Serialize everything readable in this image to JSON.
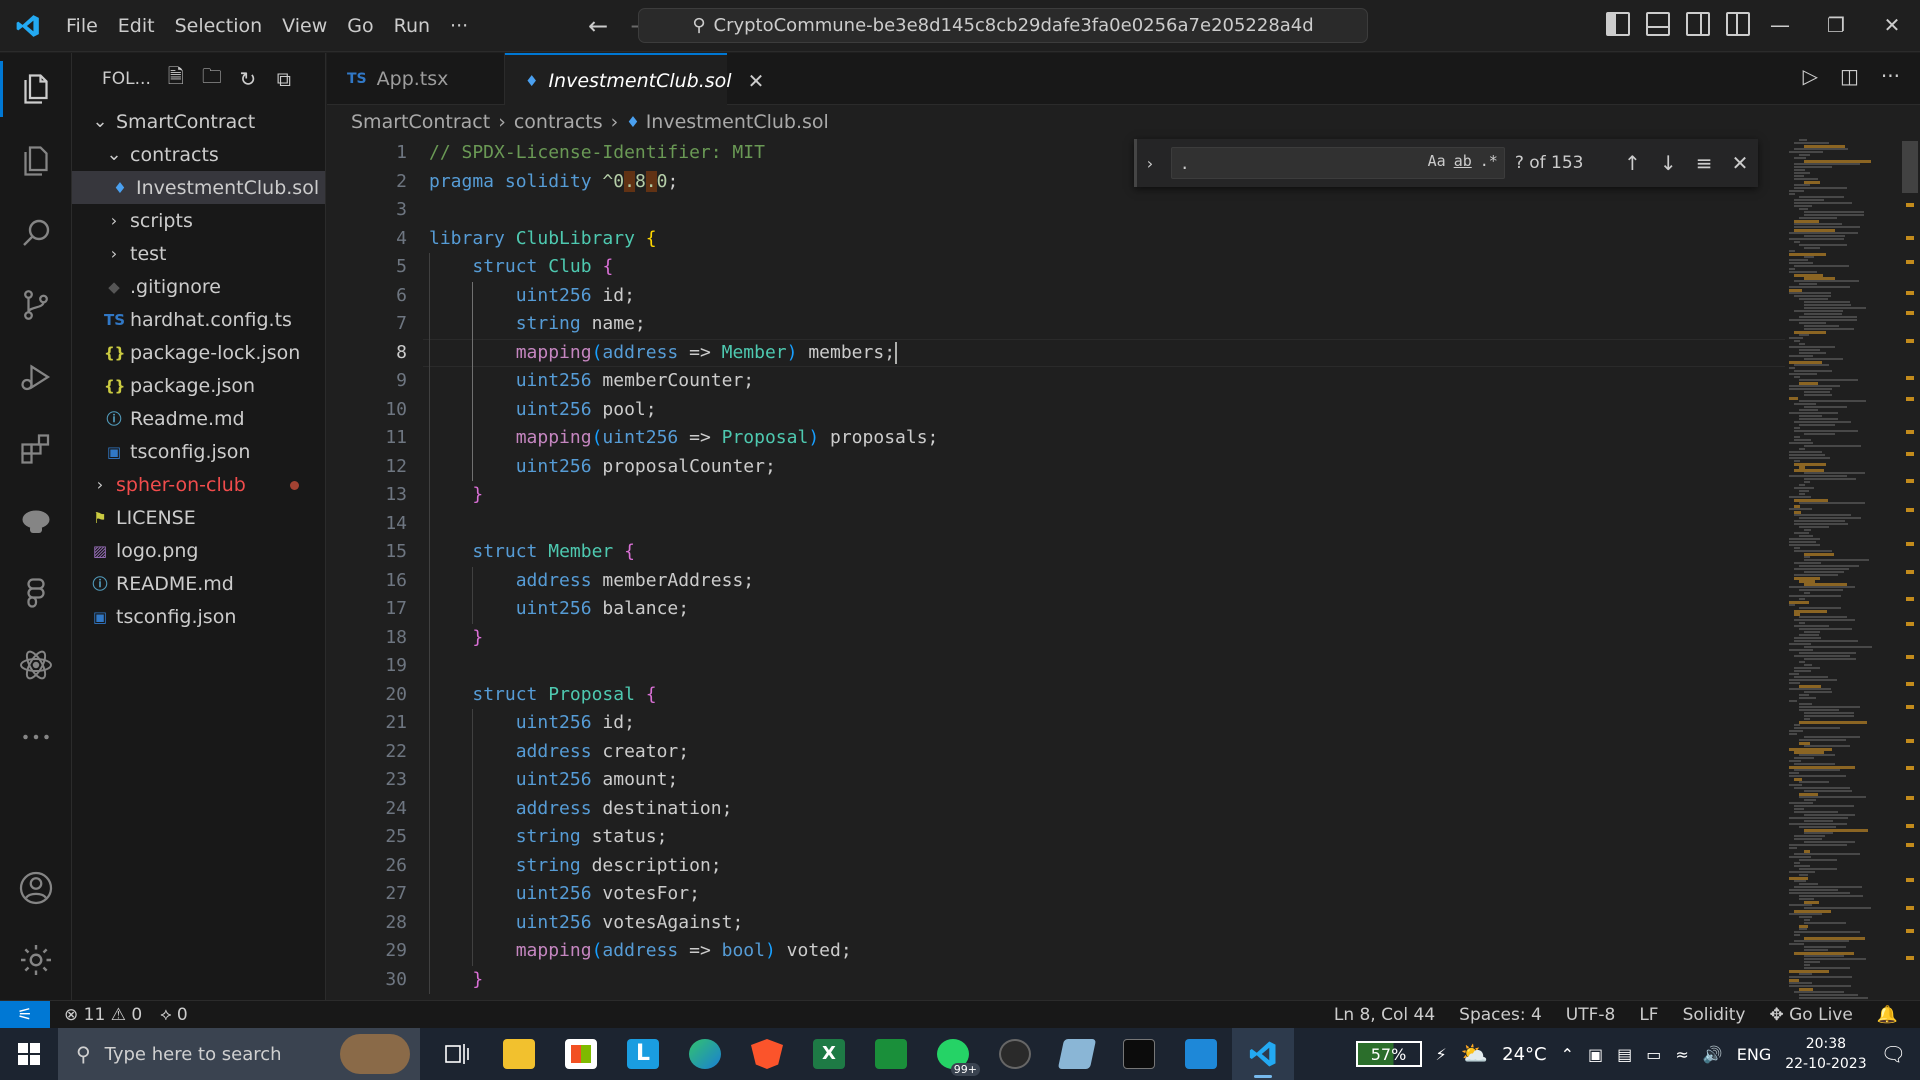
{
  "titlebar": {
    "menu": [
      "File",
      "Edit",
      "Selection",
      "View",
      "Go",
      "Run",
      "···"
    ],
    "command_center": "CryptoCommune-be3e8d145c8cb29dafe3fa0e0256a7e205228a4d"
  },
  "sidebar": {
    "header": "FOL...",
    "tree": [
      {
        "label": "SmartContract",
        "indent": 0,
        "kind": "folder-open",
        "icon": "chevron-down-icon"
      },
      {
        "label": "contracts",
        "indent": 1,
        "kind": "folder-open",
        "icon": "chevron-down-icon"
      },
      {
        "label": "InvestmentClub.sol",
        "indent": 2,
        "kind": "sol",
        "selected": true
      },
      {
        "label": "scripts",
        "indent": 1,
        "kind": "folder",
        "icon": "chevron-right-icon"
      },
      {
        "label": "test",
        "indent": 1,
        "kind": "folder",
        "icon": "chevron-right-icon"
      },
      {
        "label": ".gitignore",
        "indent": 1,
        "kind": "git"
      },
      {
        "label": "hardhat.config.ts",
        "indent": 1,
        "kind": "ts"
      },
      {
        "label": "package-lock.json",
        "indent": 1,
        "kind": "json"
      },
      {
        "label": "package.json",
        "indent": 1,
        "kind": "json"
      },
      {
        "label": "Readme.md",
        "indent": 1,
        "kind": "info"
      },
      {
        "label": "tsconfig.json",
        "indent": 1,
        "kind": "tsconfig"
      },
      {
        "label": "spher-on-club",
        "indent": 0,
        "kind": "folder",
        "icon": "chevron-right-icon",
        "modified": true
      },
      {
        "label": "LICENSE",
        "indent": 0,
        "kind": "license"
      },
      {
        "label": "logo.png",
        "indent": 0,
        "kind": "image"
      },
      {
        "label": "README.md",
        "indent": 0,
        "kind": "info"
      },
      {
        "label": "tsconfig.json",
        "indent": 0,
        "kind": "tsconfig"
      }
    ]
  },
  "tabs": [
    {
      "label": "App.tsx",
      "prefix": "TS",
      "active": false
    },
    {
      "label": "InvestmentClub.sol",
      "active": true
    }
  ],
  "breadcrumb": [
    "SmartContract",
    "contracts",
    "InvestmentClub.sol"
  ],
  "editor": {
    "current_line": 8,
    "lines": [
      "// SPDX-License-Identifier: MIT",
      "pragma solidity ^0.8.0;",
      "",
      "library ClubLibrary {",
      "    struct Club {",
      "        uint256 id;",
      "        string name;",
      "        mapping(address => Member) members;",
      "        uint256 memberCounter;",
      "        uint256 pool;",
      "        mapping(uint256 => Proposal) proposals;",
      "        uint256 proposalCounter;",
      "    }",
      "",
      "    struct Member {",
      "        address memberAddress;",
      "        uint256 balance;",
      "    }",
      "",
      "    struct Proposal {",
      "        uint256 id;",
      "        address creator;",
      "        uint256 amount;",
      "        address destination;",
      "        string status;",
      "        string description;",
      "        uint256 votesFor;",
      "        uint256 votesAgainst;",
      "        mapping(address => bool) voted;",
      "    }"
    ]
  },
  "find": {
    "query": ".",
    "match_case": "Aa",
    "whole_word": "ab",
    "regex": ".*",
    "count": "? of 153"
  },
  "statusbar": {
    "errors": "11",
    "warnings": "0",
    "ports": "0",
    "position": "Ln 8, Col 44",
    "spaces": "Spaces: 4",
    "encoding": "UTF-8",
    "eol": "LF",
    "language": "Solidity",
    "golive": "Go Live"
  },
  "taskbar": {
    "search_placeholder": "Type here to search",
    "whatsapp_badge": "99+",
    "battery": "57%",
    "weather": "24°C",
    "lang": "ENG",
    "time": "20:38",
    "date": "22-10-2023"
  }
}
